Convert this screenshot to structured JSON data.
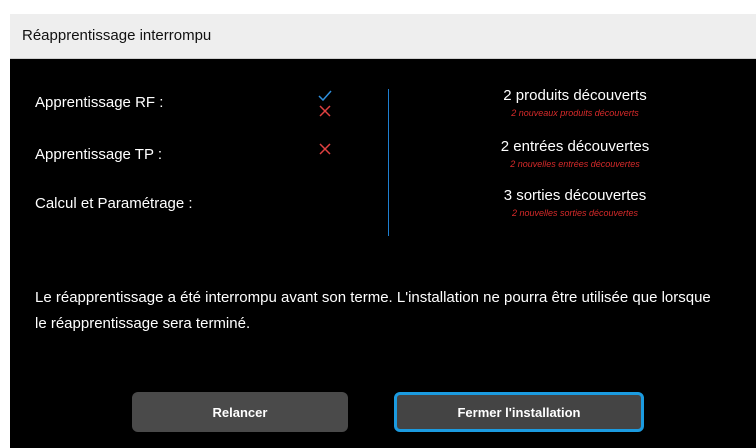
{
  "dialog": {
    "title": "Réapprentissage interrompu",
    "rows": [
      {
        "label": "Apprentissage RF :",
        "status": [
          "check",
          "cross"
        ]
      },
      {
        "label": "Apprentissage TP :",
        "status": [
          "cross"
        ]
      },
      {
        "label": "Calcul et Paramétrage :",
        "status": []
      }
    ],
    "results": [
      {
        "main": "2 produits découverts",
        "sub": "2 nouveaux produits découverts"
      },
      {
        "main": "2 entrées découvertes",
        "sub": "2 nouvelles entrées découvertes"
      },
      {
        "main": "3 sorties découvertes",
        "sub": "2 nouvelles sorties découvertes"
      }
    ],
    "message": "Le réapprentissage a été interrompu avant son terme. L'installation ne pourra être utilisée que lorsque le réapprentissage sera terminé.",
    "buttons": {
      "relancer": "Relancer",
      "fermer": "Fermer l'installation"
    },
    "colors": {
      "check": "#2f8fdc",
      "cross": "#e04040",
      "sub_text": "#d72a2a",
      "focus_border": "#1b9be0"
    },
    "icons": {
      "check": "check-icon",
      "cross": "cross-icon"
    }
  }
}
